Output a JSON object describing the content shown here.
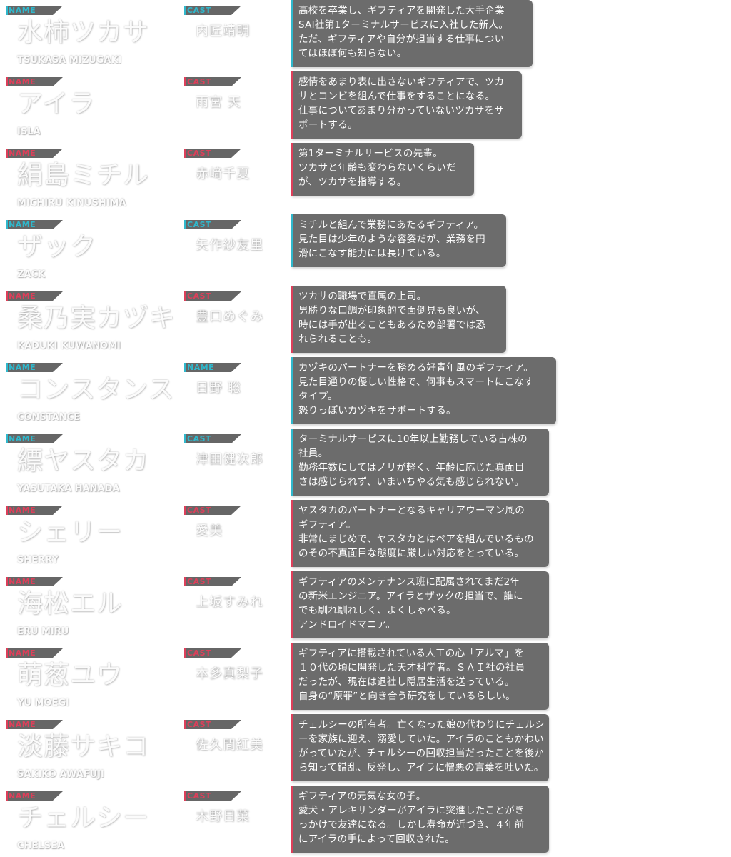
{
  "labels": {
    "name_tag": "NAME",
    "cast_tag": "CAST"
  },
  "colors": {
    "male": "#2fb8cc",
    "female": "#dd3f5a",
    "tag_background": "#666666",
    "description_background": "#6c6c6c"
  },
  "characters": [
    {
      "name": "水柿ツカサ",
      "name_en": "TSUKASA MIZUGAKI",
      "cast": "内匠靖明",
      "description": "高校を卒業し、ギフティアを開発した大手企業\nSAI社第1ターミナルサービスに入社した新人。\nただ、ギフティアや自分が担当する仕事につい\nてはほぼ何も知らない。",
      "name_tag_color": "#2fb8cc",
      "cast_tag_color": "#2fb8cc",
      "box_accent": "#2fb8cc"
    },
    {
      "name": "アイラ",
      "name_en": "ISLA",
      "cast": "雨宮 天",
      "description": "感情をあまり表に出さないギフティアで、ツカ\nサとコンビを組んで仕事をすることになる。\n仕事についてあまり分かっていないツカサをサ\nポートする。",
      "name_tag_color": "#dd3f5a",
      "cast_tag_color": "#dd3f5a",
      "box_accent": "#dd3f5a"
    },
    {
      "name": "絹島ミチル",
      "name_en": "MICHIRU KINUSHIMA",
      "cast": "赤﨑千夏",
      "description": "第1ターミナルサービスの先輩。\nツカサと年齢も変わらないくらいだ\nが、ツカサを指導する。",
      "name_tag_color": "#dd3f5a",
      "cast_tag_color": "#dd3f5a",
      "box_accent": "#dd3f5a"
    },
    {
      "name": "ザック",
      "name_en": "ZACK",
      "cast": "矢作紗友里",
      "description": "ミチルと組んで業務にあたるギフティア。\n見た目は少年のような容姿だが、業務を円\n滑にこなす能力には長けている。",
      "name_tag_color": "#2fb8cc",
      "cast_tag_color": "#2fb8cc",
      "box_accent": "#2fb8cc"
    },
    {
      "name": "桑乃実カヅキ",
      "name_en": "KADUKI KUWANOMI",
      "cast": "豊口めぐみ",
      "description": "ツカサの職場で直属の上司。\n男勝りな口調が印象的で面倒見も良いが、\n時には手が出ることもあるため部署では恐\nれられることも。",
      "name_tag_color": "#dd3f5a",
      "cast_tag_color": "#dd3f5a",
      "box_accent": "#dd3f5a"
    },
    {
      "name": "コンスタンス",
      "name_en": "CONSTANCE",
      "cast": "日野 聡",
      "description": "カヅキのパートナーを務める好青年風のギフティア。\n見た目通りの優しい性格で、何事もスマートにこなす\nタイプ。\n怒りっぽいカヅキをサポートする。",
      "name_tag_color": "#2fb8cc",
      "cast_tag_color": "#2fb8cc",
      "box_accent": "#2fb8cc"
    },
    {
      "name": "縹ヤスタカ",
      "name_en": "YASUTAKA HANADA",
      "cast": "津田健次郎",
      "description": "ターミナルサービスに10年以上勤務している古株の\n社員。\n勤務年数にしてはノリが軽く、年齢に応じた真面目\nさは感じられず、いまいちやる気も感じられない。",
      "name_tag_color": "#2fb8cc",
      "cast_tag_color": "#2fb8cc",
      "box_accent": "#2fb8cc"
    },
    {
      "name": "シェリー",
      "name_en": "SHERRY",
      "cast": "愛美",
      "description": "ヤスタカのパートナーとなるキャリアウーマン風の\nギフティア。\n非常にまじめで、ヤスタカとはペアを組んでいるもの\nのその不真面目な態度に厳しい対応をとっている。",
      "name_tag_color": "#dd3f5a",
      "cast_tag_color": "#dd3f5a",
      "box_accent": "#dd3f5a"
    },
    {
      "name": "海松エル",
      "name_en": "ERU MIRU",
      "cast": "上坂すみれ",
      "description": "ギフティアのメンテナンス班に配属されてまだ2年\nの新米エンジニア。アイラとザックの担当で、誰に\nでも馴れ馴れしく、よくしゃべる。\nアンドロイドマニア。",
      "name_tag_color": "#dd3f5a",
      "cast_tag_color": "#dd3f5a",
      "box_accent": "#dd3f5a"
    },
    {
      "name": "萌葱ユウ",
      "name_en": "YU MOEGI",
      "cast": "本多真梨子",
      "description": "ギフティアに搭載されている人工の心「アルマ」を\n１０代の頃に開発した天才科学者。ＳＡＩ社の社員\nだったが、現在は退社し隠居生活を送っている。\n自身の“原罪”と向き合う研究をしているらしい。",
      "name_tag_color": "#dd3f5a",
      "cast_tag_color": "#dd3f5a",
      "box_accent": "#dd3f5a"
    },
    {
      "name": "淡藤サキコ",
      "name_en": "SAKIKO AWAFUJI",
      "cast": "佐久間紅美",
      "description": "チェルシーの所有者。亡くなった娘の代わりにチェルシ\nーを家族に迎え、溺愛していた。アイラのこともかわい\nがっていたが、チェルシーの回収担当だったことを後か\nら知って錯乱、反発し、アイラに憎悪の言葉を吐いた。",
      "name_tag_color": "#dd3f5a",
      "cast_tag_color": "#dd3f5a",
      "box_accent": "#dd3f5a"
    },
    {
      "name": "チェルシー",
      "name_en": "CHELSEA",
      "cast": "木野日菜",
      "description": "ギフティアの元気な女の子。\n愛犬・アレキサンダーがアイラに突進したことがき\nっかけで友達になる。しかし寿命が近づき、４年前\nにアイラの手によって回収された。",
      "name_tag_color": "#dd3f5a",
      "cast_tag_color": "#dd3f5a",
      "box_accent": "#dd3f5a"
    }
  ]
}
